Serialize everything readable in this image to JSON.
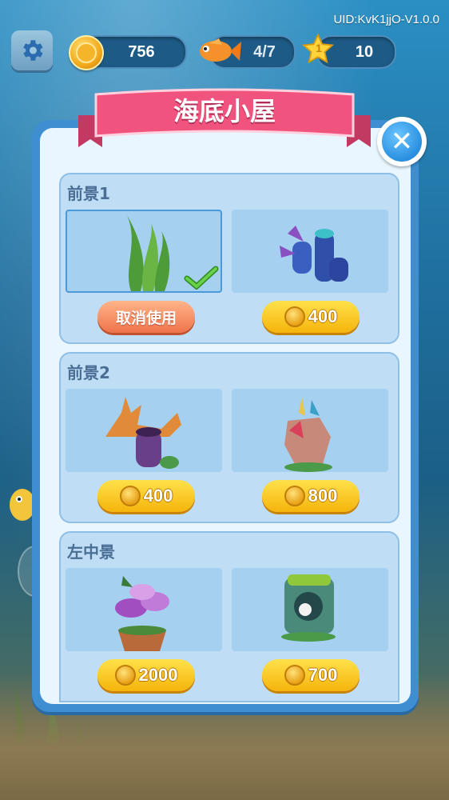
{
  "status": {
    "uid": "UID:KvK1jjO-V1.0.0",
    "coins": "756",
    "fish": "4/7",
    "stars": "10",
    "star_level": "1"
  },
  "dialog": {
    "title": "海底小屋",
    "close_icon": "close-icon",
    "sections": [
      {
        "title": "前景1",
        "left_action": "取消使用",
        "right_price": "400"
      },
      {
        "title": "前景2",
        "left_price": "400",
        "right_price": "800"
      },
      {
        "title": "左中景",
        "left_price": "2000",
        "right_price": "700"
      }
    ]
  },
  "colors": {
    "ribbon": "#f0547e",
    "panel_border": "#3f8ed1",
    "price_button": "#f5b40c",
    "cancel_button": "#f0734a"
  }
}
